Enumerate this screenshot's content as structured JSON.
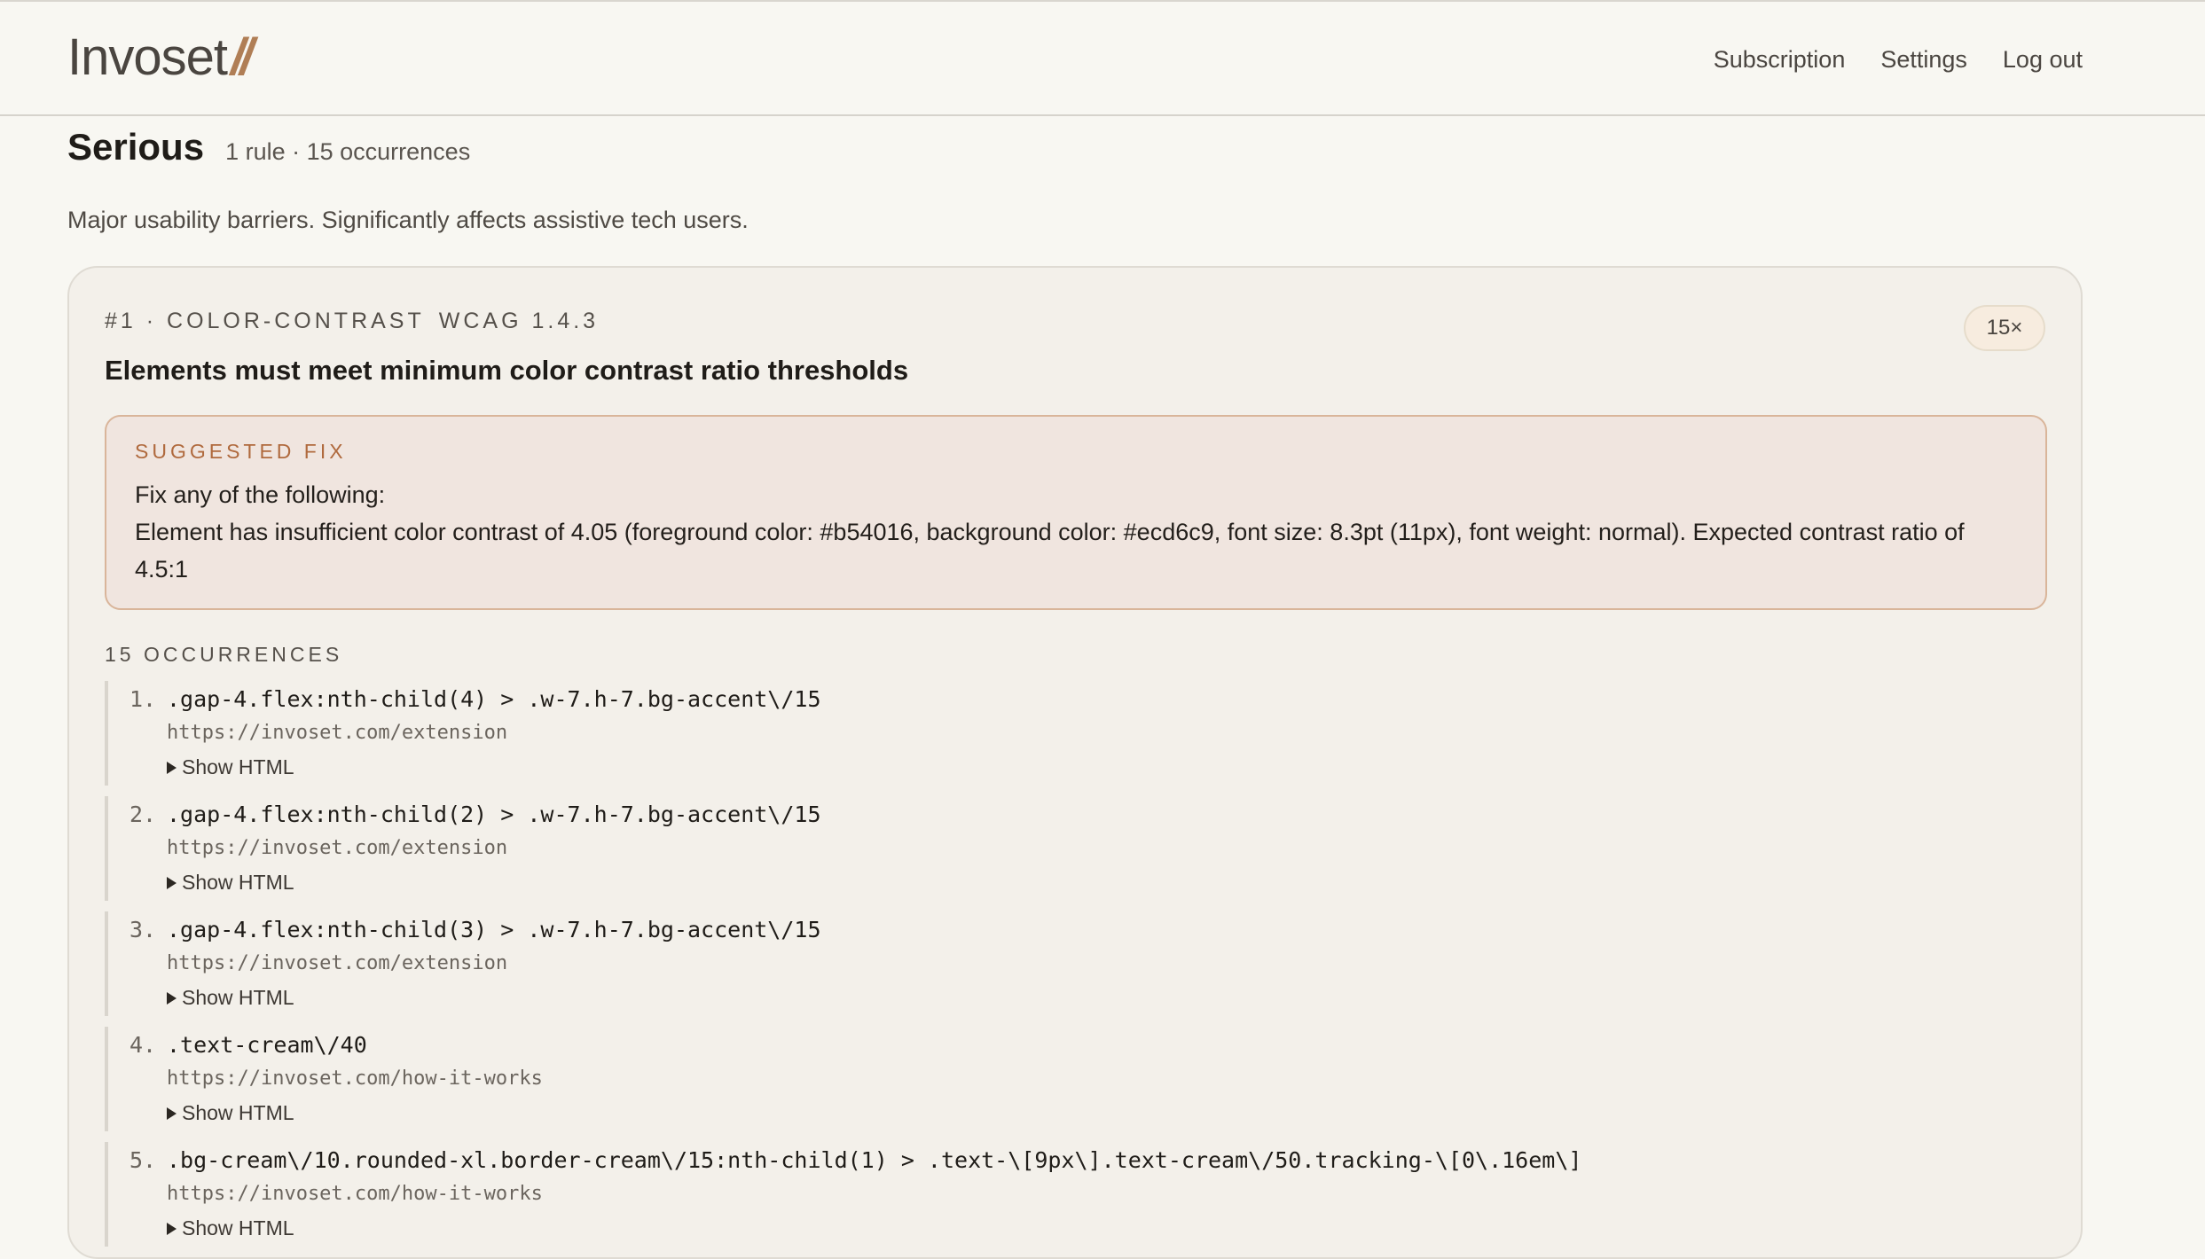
{
  "header": {
    "logo_text": "Invoset",
    "logo_mark": "//",
    "nav": [
      "Subscription",
      "Settings",
      "Log out"
    ]
  },
  "section": {
    "title": "Serious",
    "meta": "1 rule · 15 occurrences",
    "description": "Major usability barriers. Significantly affects assistive tech users."
  },
  "rule": {
    "id_label": "#1 · COLOR-CONTRAST",
    "wcag": "WCAG 1.4.3",
    "count_badge": "15×",
    "title": "Elements must meet minimum color contrast ratio thresholds",
    "fix_label": "SUGGESTED FIX",
    "fix_line1": "Fix any of the following:",
    "fix_line2": "Element has insufficient color contrast of 4.05 (foreground color: #b54016, background color: #ecd6c9, font size: 8.3pt (11px), font weight: normal). Expected contrast ratio of 4.5:1",
    "occurrences_label": "15 OCCURRENCES",
    "occurrences": [
      {
        "num": "1.",
        "selector": ".gap-4.flex:nth-child(4) > .w-7.h-7.bg-accent\\/15",
        "url": "https://invoset.com/extension",
        "toggle": "Show HTML"
      },
      {
        "num": "2.",
        "selector": ".gap-4.flex:nth-child(2) > .w-7.h-7.bg-accent\\/15",
        "url": "https://invoset.com/extension",
        "toggle": "Show HTML"
      },
      {
        "num": "3.",
        "selector": ".gap-4.flex:nth-child(3) > .w-7.h-7.bg-accent\\/15",
        "url": "https://invoset.com/extension",
        "toggle": "Show HTML"
      },
      {
        "num": "4.",
        "selector": ".text-cream\\/40",
        "url": "https://invoset.com/how-it-works",
        "toggle": "Show HTML"
      },
      {
        "num": "5.",
        "selector": ".bg-cream\\/10.rounded-xl.border-cream\\/15:nth-child(1) > .text-\\[9px\\].text-cream\\/50.tracking-\\[0\\.16em\\]",
        "url": "https://invoset.com/how-it-works",
        "toggle": "Show HTML"
      }
    ]
  },
  "colors": {
    "background": "#f8f7f2",
    "card": "#f3f0ea",
    "fix_bg": "#f0e5df",
    "fix_border": "#d9b59a",
    "accent": "#b06a3e"
  }
}
